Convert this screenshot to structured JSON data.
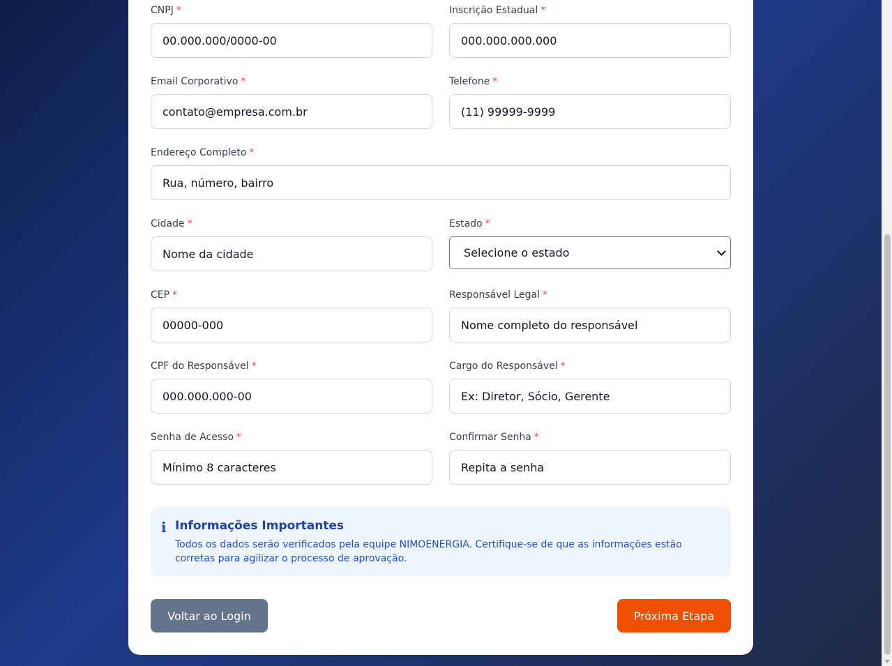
{
  "form": {
    "cnpj": {
      "label": "CNPJ",
      "placeholder": "00.000.000/0000-00"
    },
    "inscricao": {
      "label": "Inscrição Estadual",
      "placeholder": "000.000.000.000"
    },
    "email": {
      "label": "Email Corporativo",
      "placeholder": "contato@empresa.com.br"
    },
    "telefone": {
      "label": "Telefone",
      "placeholder": "(11) 99999-9999"
    },
    "endereco": {
      "label": "Endereço Completo",
      "placeholder": "Rua, número, bairro"
    },
    "cidade": {
      "label": "Cidade",
      "placeholder": "Nome da cidade"
    },
    "estado": {
      "label": "Estado",
      "selected": "Selecione o estado"
    },
    "cep": {
      "label": "CEP",
      "placeholder": "00000-000"
    },
    "responsavel": {
      "label": "Responsável Legal",
      "placeholder": "Nome completo do responsável"
    },
    "cpf": {
      "label": "CPF do Responsável",
      "placeholder": "000.000.000-00"
    },
    "cargo": {
      "label": "Cargo do Responsável",
      "placeholder": "Ex: Diretor, Sócio, Gerente"
    },
    "senha": {
      "label": "Senha de Acesso",
      "placeholder": "Mínimo 8 caracteres"
    },
    "confirmar": {
      "label": "Confirmar Senha",
      "placeholder": "Repita a senha"
    },
    "required_mark": "*"
  },
  "info": {
    "icon": "info-icon",
    "title": "Informações Importantes",
    "text": "Todos os dados serão verificados pela equipe NIMOENERGIA. Certifique-se de que as informações estão corretas para agilizar o processo de aprovação."
  },
  "buttons": {
    "back": "Voltar ao Login",
    "next": "Próxima Etapa"
  },
  "colors": {
    "accent": "#f04e00",
    "secondary_button": "#64748b",
    "info_bg": "#eff6ff",
    "required": "#ef4444"
  }
}
